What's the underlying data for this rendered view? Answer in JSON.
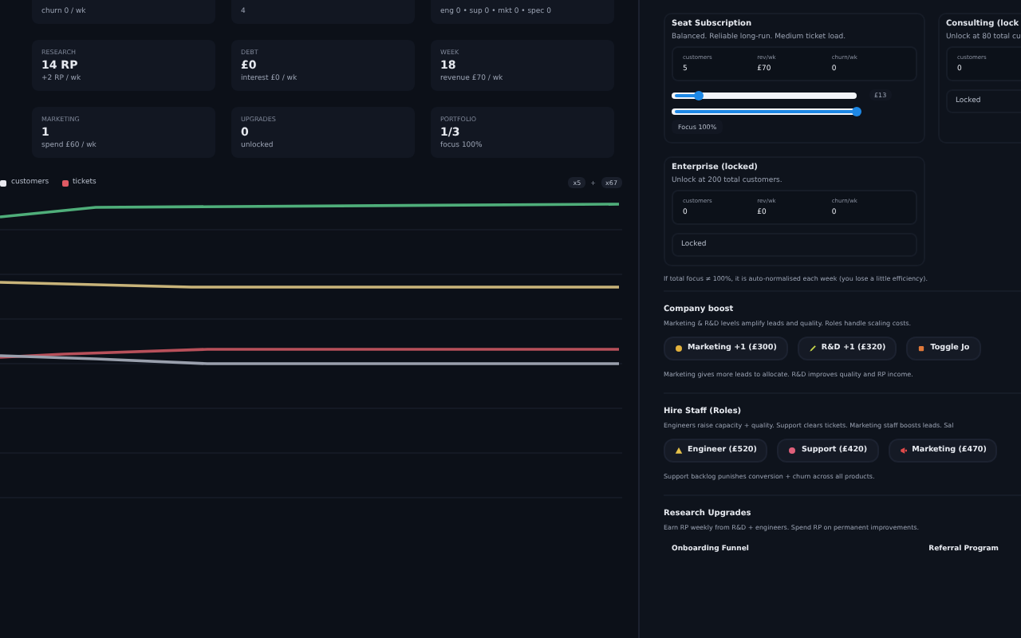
{
  "stat_cards": [
    {
      "sub": "churn 0 / wk"
    },
    {
      "sub": "4"
    },
    {
      "sub": "eng 0 • sup 0 • mkt 0 • spec 0"
    },
    {
      "label": "RESEARCH",
      "value": "14 RP",
      "sub": "+2 RP / wk"
    },
    {
      "label": "DEBT",
      "value": "£0",
      "sub": "interest £0 / wk"
    },
    {
      "label": "WEEK",
      "value": "18",
      "sub": "revenue £70 / wk"
    },
    {
      "label": "MARKETING",
      "value": "1",
      "sub": "spend £60 / wk"
    },
    {
      "label": "UPGRADES",
      "value": "0",
      "sub": "unlocked"
    },
    {
      "label": "PORTFOLIO",
      "value": "1/3",
      "sub": "focus 100%"
    }
  ],
  "chart": {
    "legend": [
      {
        "label": "customers",
        "color": "#e8e8ee"
      },
      {
        "label": "tickets",
        "color": "#e05a64"
      }
    ],
    "range": [
      "x5",
      "+",
      "x67"
    ]
  },
  "products": [
    {
      "kind": "active",
      "title": "Seat Subscription",
      "desc": "Balanced. Reliable long-run. Medium ticket load.",
      "stats": [
        {
          "label": "customers",
          "value": "5"
        },
        {
          "label": "rev/wk",
          "value": "£70"
        },
        {
          "label": "churn/wk",
          "value": "0"
        }
      ],
      "sliders": [
        {
          "level": 0.15,
          "reading": "£13"
        },
        {
          "level": 1
        }
      ],
      "focus": "Focus 100%"
    },
    {
      "kind": "locked",
      "title": "Consulting (lock",
      "desc": "Unlock at 80 total cu",
      "stats": [
        {
          "label": "customers",
          "value": "0"
        }
      ],
      "status": "Locked"
    },
    {
      "kind": "locked",
      "title": "Enterprise (locked)",
      "desc": "Unlock at 200 total customers.",
      "stats": [
        {
          "label": "customers",
          "value": "0"
        },
        {
          "label": "rev/wk",
          "value": "£0"
        },
        {
          "label": "churn/wk",
          "value": "0"
        }
      ],
      "status": "Locked"
    }
  ],
  "focus_note": "If total focus ≠ 100%, it is auto-normalised each week (you lose a little efficiency).",
  "sections": [
    {
      "title": "Company boost",
      "desc": "Marketing & R&D levels amplify leads and quality. Roles handle scaling costs.",
      "buttons": [
        {
          "label": "Marketing +1 (£300)"
        },
        {
          "label": "R&D +1 (£320)"
        },
        {
          "label": "Toggle Jo"
        }
      ],
      "note": "Marketing gives more leads to allocate. R&D improves quality and RP income."
    },
    {
      "title": "Hire Staff (Roles)",
      "desc": "Engineers raise capacity + quality. Support clears tickets. Marketing staff boosts leads. Sal",
      "buttons": [
        {
          "label": "Engineer (£520)"
        },
        {
          "label": "Support (£420)"
        },
        {
          "label": "Marketing (£470)"
        }
      ],
      "note": "Support backlog punishes conversion + churn across all products."
    },
    {
      "title": "Research Upgrades",
      "desc": "Earn RP weekly from R&D + engineers. Spend RP on permanent improvements.",
      "upgrades": [
        "Onboarding Funnel",
        "Referral Program"
      ]
    }
  ]
}
